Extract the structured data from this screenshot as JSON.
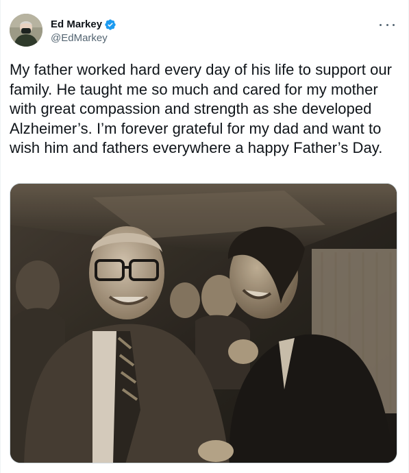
{
  "author": {
    "display_name": "Ed Markey",
    "handle": "@EdMarkey",
    "verified": true
  },
  "more_icon": "more-horizontal-icon",
  "tweet_text": "My father worked hard every day of his life to support our family. He taught me so much and cared for my mother with great compassion and strength as she developed Alzheimer’s. I’m forever grateful for my dad and want to wish him and fathers everywhere a happy Father’s Day.",
  "colors": {
    "verified_blue": "#1d9bf0",
    "text_primary": "#0f1419",
    "text_secondary": "#536471"
  }
}
